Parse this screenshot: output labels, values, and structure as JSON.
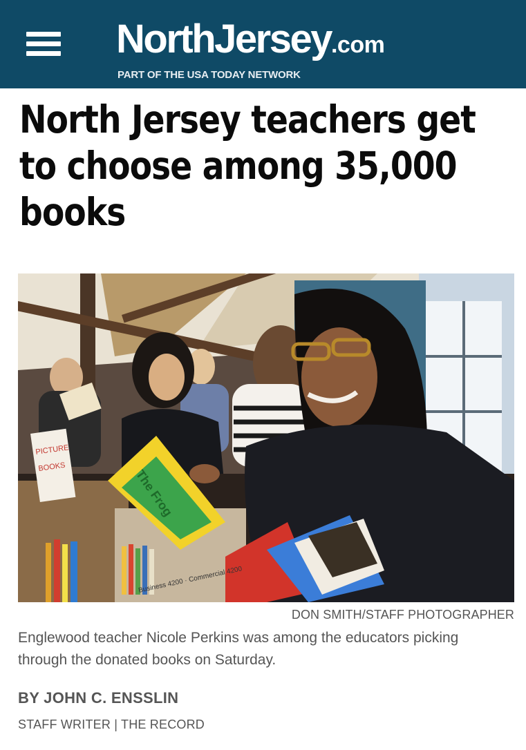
{
  "header": {
    "logo_main": "NorthJersey",
    "logo_suffix": ".com",
    "tagline": "PART OF THE USA TODAY NETWORK",
    "background_color": "#0f4a66",
    "menu_icon": "hamburger-menu-icon"
  },
  "article": {
    "headline": "North Jersey teachers get to choose among 35,000 books",
    "photo_credit": "DON SMITH/STAFF PHOTOGRAPHER",
    "caption": "Englewood teacher Nicole Perkins was among the educators picking through the donated books on Saturday.",
    "byline": "BY JOHN C. ENSSLIN",
    "writer_role": "STAFF WRITER | THE RECORD"
  }
}
